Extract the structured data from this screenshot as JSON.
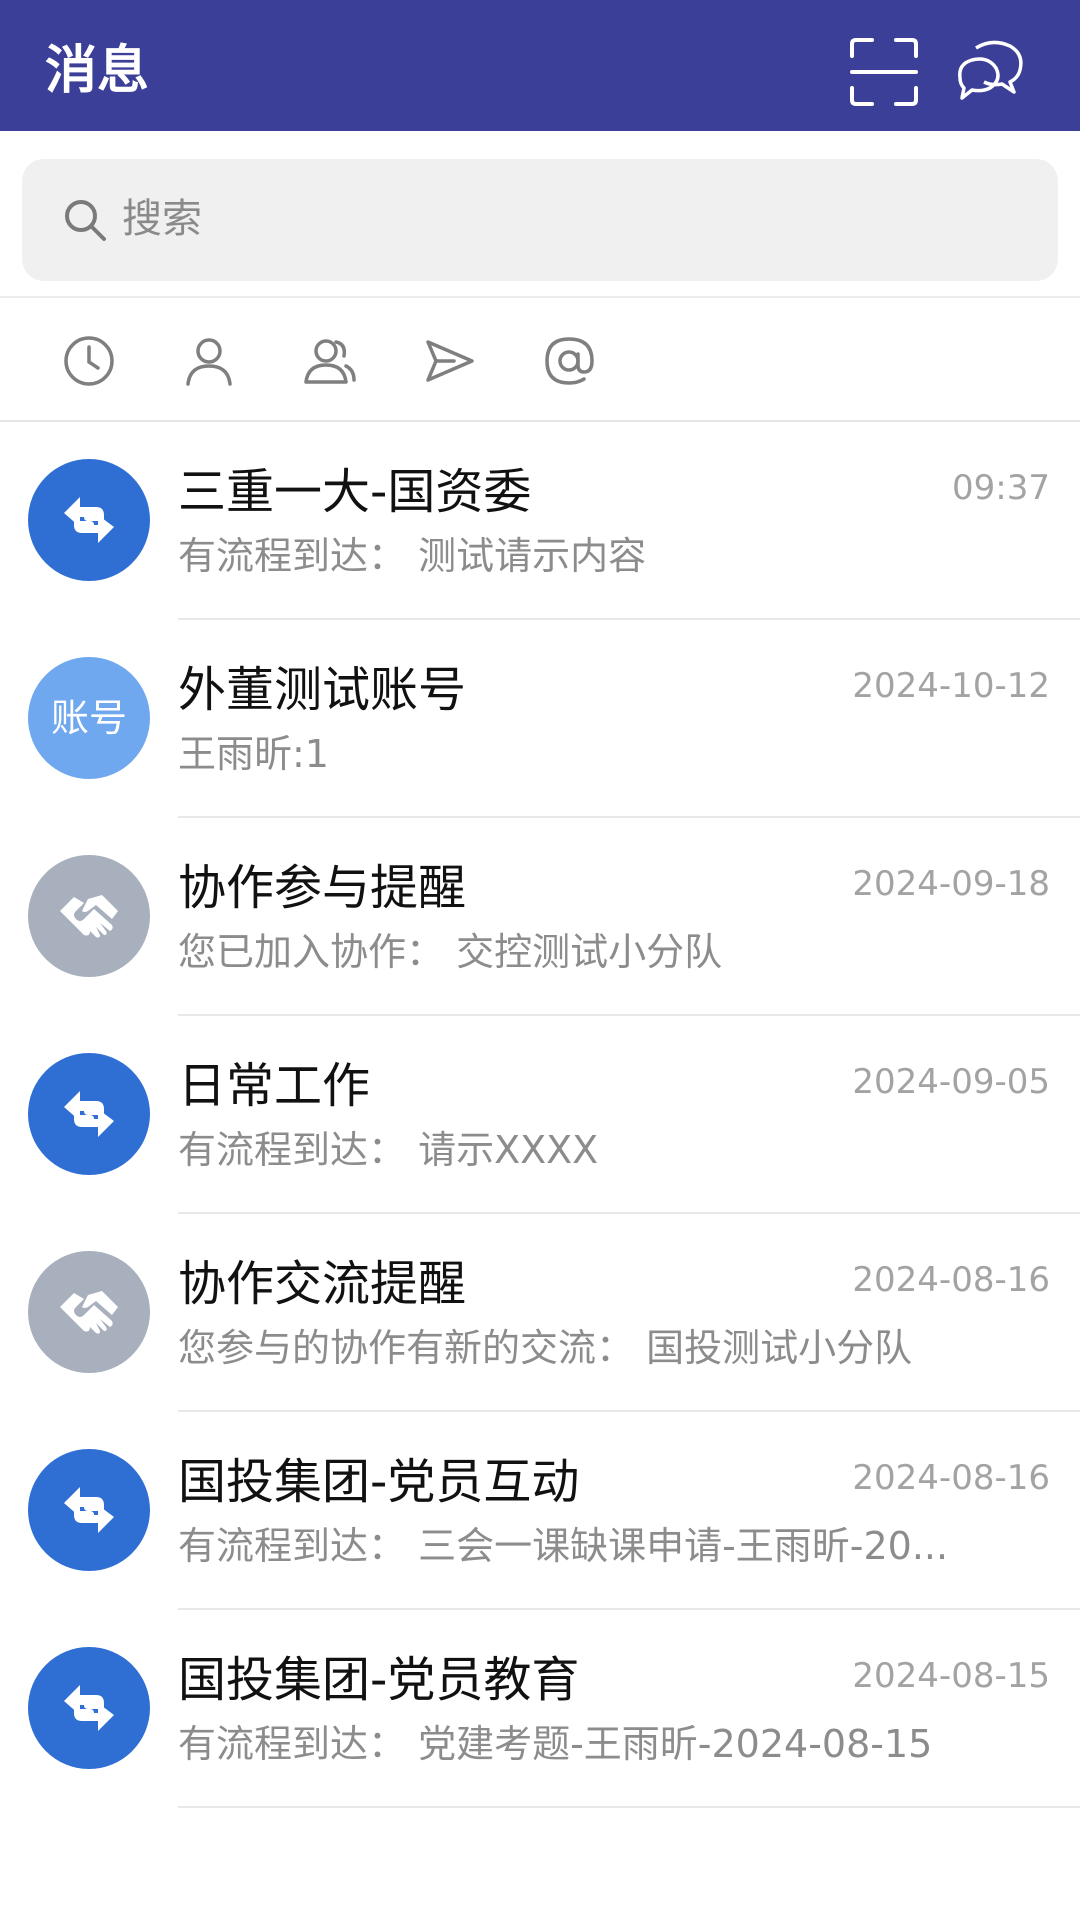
{
  "header": {
    "title": "消息",
    "icons": [
      "scan-icon",
      "chat-bubbles-icon"
    ],
    "background": "#3b3f98"
  },
  "search": {
    "placeholder": "搜索",
    "icon": "search-icon"
  },
  "filters": [
    {
      "name": "recent",
      "icon": "clock-icon"
    },
    {
      "name": "contacts",
      "icon": "person-icon"
    },
    {
      "name": "groups",
      "icon": "group-icon"
    },
    {
      "name": "sent",
      "icon": "send-icon"
    },
    {
      "name": "mentions",
      "icon": "at-icon"
    }
  ],
  "conversations": [
    {
      "title": "三重一大-国资委",
      "time": "09:37",
      "preview": "有流程到达： 测试请示内容",
      "avatar": {
        "type": "icon",
        "icon": "workflow-arrows-icon",
        "color": "#2f6fd4"
      }
    },
    {
      "title": "外董测试账号",
      "time": "2024-10-12",
      "preview": "王雨昕:1",
      "avatar": {
        "type": "text",
        "text": "账号",
        "color": "#6fa8ee"
      }
    },
    {
      "title": "协作参与提醒",
      "time": "2024-09-18",
      "preview": "您已加入协作： 交控测试小分队",
      "avatar": {
        "type": "icon",
        "icon": "handshake-icon",
        "color": "#a7b0bc"
      }
    },
    {
      "title": "日常工作",
      "time": "2024-09-05",
      "preview": "有流程到达： 请示XXXX",
      "avatar": {
        "type": "icon",
        "icon": "workflow-arrows-icon",
        "color": "#2f6fd4"
      }
    },
    {
      "title": "协作交流提醒",
      "time": "2024-08-16",
      "preview": "您参与的协作有新的交流： 国投测试小分队",
      "avatar": {
        "type": "icon",
        "icon": "handshake-icon",
        "color": "#a7b0bc"
      }
    },
    {
      "title": "国投集团-党员互动",
      "time": "2024-08-16",
      "preview": "有流程到达： 三会一课缺课申请-王雨昕-20...",
      "avatar": {
        "type": "icon",
        "icon": "workflow-arrows-icon",
        "color": "#2f6fd4"
      }
    },
    {
      "title": "国投集团-党员教育",
      "time": "2024-08-15",
      "preview": "有流程到达： 党建考题-王雨昕-2024-08-15",
      "avatar": {
        "type": "icon",
        "icon": "workflow-arrows-icon",
        "color": "#2f6fd4"
      }
    }
  ]
}
